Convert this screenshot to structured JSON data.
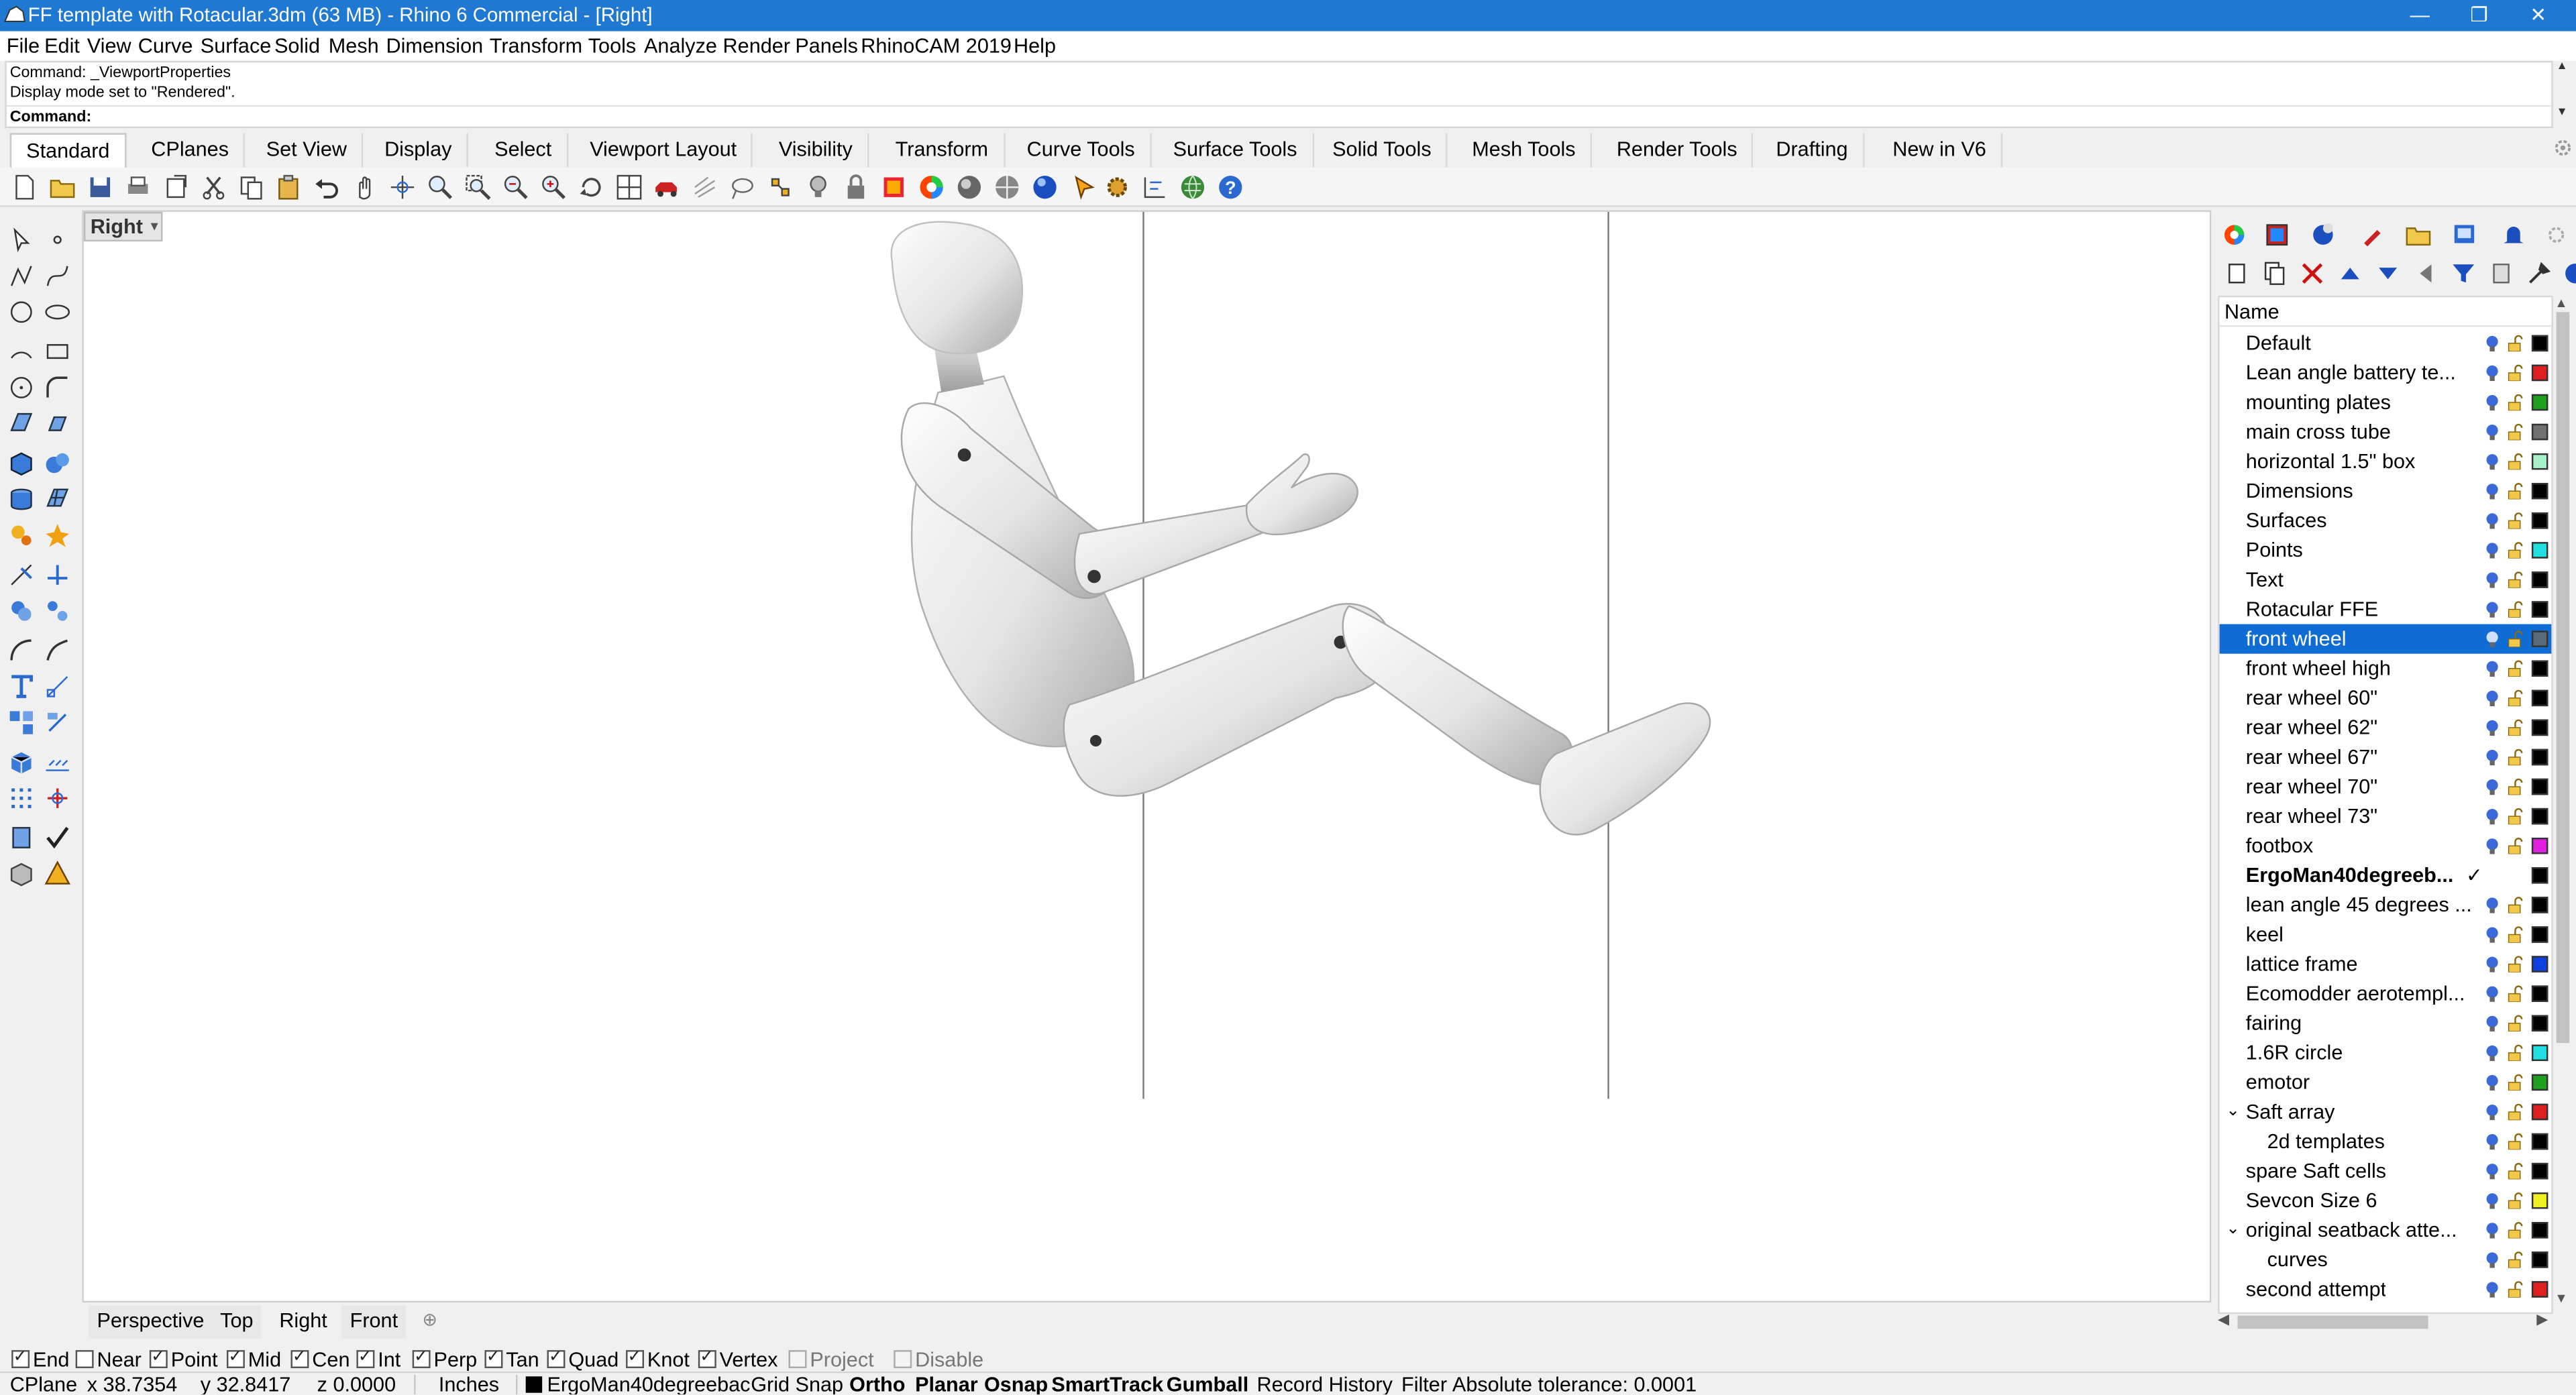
{
  "window": {
    "title": "FF template with Rotacular.3dm (63 MB) - Rhino 6 Commercial - [Right]",
    "minimize": "—",
    "maximize": "❐",
    "close": "✕"
  },
  "menu": [
    "File",
    "Edit",
    "View",
    "Curve",
    "Surface",
    "Solid",
    "Mesh",
    "Dimension",
    "Transform",
    "Tools",
    "Analyze",
    "Render",
    "Panels",
    "RhinoCAM 2019",
    "Help"
  ],
  "command_history": [
    "Command: _ViewportProperties",
    "Display mode set to \"Rendered\"."
  ],
  "command_prompt": "Command:",
  "toolbar_tabs": [
    "Standard",
    "CPlanes",
    "Set View",
    "Display",
    "Select",
    "Viewport Layout",
    "Visibility",
    "Transform",
    "Curve Tools",
    "Surface Tools",
    "Solid Tools",
    "Mesh Tools",
    "Render Tools",
    "Drafting",
    "New in V6"
  ],
  "active_toolbar_tab": "Standard",
  "toolbar_icons": [
    "new-icon",
    "open-icon",
    "save-icon",
    "print-icon",
    "import-icon",
    "cut-icon",
    "copy-icon",
    "paste-icon",
    "undo-icon",
    "pan-icon",
    "rotate-view-icon",
    "zoom-icon",
    "zoom-window-icon",
    "zoom-extents-icon",
    "zoom-selected-icon",
    "rotate-3d-icon",
    "four-view-icon",
    "car-icon",
    "grid-icon",
    "lasso-icon",
    "snap-icon",
    "light-icon",
    "lock-icon",
    "material-icon",
    "color-wheel-icon",
    "shade-icon",
    "render-icon",
    "sphere-icon",
    "pointer-icon",
    "gear-icon",
    "dimension-icon",
    "globe-icon",
    "help-icon"
  ],
  "viewport": {
    "name": "Right",
    "tabs": [
      "Perspective",
      "Top",
      "Right",
      "Front"
    ],
    "active_tab": "Right",
    "add_tab": "⊕"
  },
  "osnaps": [
    {
      "label": "End",
      "checked": true
    },
    {
      "label": "Near",
      "checked": false
    },
    {
      "label": "Point",
      "checked": true
    },
    {
      "label": "Mid",
      "checked": true
    },
    {
      "label": "Cen",
      "checked": true
    },
    {
      "label": "Int",
      "checked": true
    },
    {
      "label": "Perp",
      "checked": true
    },
    {
      "label": "Tan",
      "checked": true
    },
    {
      "label": "Quad",
      "checked": true
    },
    {
      "label": "Knot",
      "checked": true
    },
    {
      "label": "Vertex",
      "checked": true
    },
    {
      "label": "Project",
      "checked": false,
      "disabled": true
    },
    {
      "label": "Disable",
      "checked": false,
      "disabled": true
    }
  ],
  "status": {
    "cplane": "CPlane",
    "x": "x 38.7354",
    "y": "y 32.8417",
    "z": "z 0.0000",
    "units": "Inches",
    "layer": "ErgoMan40degreebac",
    "grid_snap": "Grid Snap",
    "ortho": "Ortho",
    "planar": "Planar",
    "osnap": "Osnap",
    "smarttrack": "SmartTrack",
    "gumball": "Gumball",
    "record_history": "Record History",
    "filter": "Filter",
    "tolerance": "Absolute tolerance: 0.0001"
  },
  "layers_panel": {
    "header": "Name",
    "tab_icons": [
      "color-wheel-icon",
      "layers-icon",
      "render-icon",
      "brush-icon",
      "folder-icon",
      "display-icon",
      "bell-icon",
      "settings-icon"
    ],
    "tool_icons": [
      "new-layer-icon",
      "new-sublayer-icon",
      "delete-icon",
      "move-up-icon",
      "move-down-icon",
      "move-left-icon",
      "filter-icon",
      "copy-icon",
      "tools-icon"
    ],
    "rows": [
      {
        "name": "Default",
        "color": "#000000",
        "indent": 0
      },
      {
        "name": "Lean angle battery te...",
        "color": "#e02020",
        "indent": 0
      },
      {
        "name": "mounting plates",
        "color": "#1fa01f",
        "indent": 0
      },
      {
        "name": "main cross tube",
        "color": "#707070",
        "indent": 0
      },
      {
        "name": "horizontal 1.5\" box",
        "color": "#a8f0c8",
        "indent": 0
      },
      {
        "name": "Dimensions",
        "color": "#000000",
        "indent": 0
      },
      {
        "name": "Surfaces",
        "color": "#000000",
        "indent": 0
      },
      {
        "name": "Points",
        "color": "#20e0e0",
        "indent": 0
      },
      {
        "name": "Text",
        "color": "#000000",
        "indent": 0
      },
      {
        "name": "Rotacular FFE",
        "color": "#000000",
        "indent": 0
      },
      {
        "name": "front wheel",
        "color": "#5a6a7a",
        "indent": 0,
        "selected": true
      },
      {
        "name": "front wheel high",
        "color": "#000000",
        "indent": 0
      },
      {
        "name": "rear wheel 60\"",
        "color": "#000000",
        "indent": 0
      },
      {
        "name": "rear wheel 62\"",
        "color": "#000000",
        "indent": 0
      },
      {
        "name": "rear wheel 67\"",
        "color": "#000000",
        "indent": 0
      },
      {
        "name": "rear wheel 70\"",
        "color": "#000000",
        "indent": 0
      },
      {
        "name": "rear wheel 73\"",
        "color": "#000000",
        "indent": 0
      },
      {
        "name": "footbox",
        "color": "#e020e0",
        "indent": 0
      },
      {
        "name": "ErgoMan40degreeb...",
        "color": "#000000",
        "indent": 0,
        "current": true,
        "check": "✓"
      },
      {
        "name": "lean angle 45 degrees ...",
        "color": "#000000",
        "indent": 0
      },
      {
        "name": "keel",
        "color": "#000000",
        "indent": 0
      },
      {
        "name": "lattice frame",
        "color": "#1040e0",
        "indent": 0
      },
      {
        "name": "Ecomodder aerotempl...",
        "color": "#000000",
        "indent": 0
      },
      {
        "name": "fairing",
        "color": "#000000",
        "indent": 0
      },
      {
        "name": "1.6R circle",
        "color": "#20e0e0",
        "indent": 0
      },
      {
        "name": "emotor",
        "color": "#1fa01f",
        "indent": 0
      },
      {
        "name": "Saft array",
        "color": "#e02020",
        "indent": 0,
        "expanded": true,
        "chev": "⌄"
      },
      {
        "name": "2d templates",
        "color": "#000000",
        "indent": 1
      },
      {
        "name": "spare Saft cells",
        "color": "#000000",
        "indent": 0
      },
      {
        "name": "Sevcon Size 6",
        "color": "#f0f020",
        "indent": 0
      },
      {
        "name": "original seatback atte...",
        "color": "#000000",
        "indent": 0,
        "expanded": true,
        "chev": "⌄"
      },
      {
        "name": "curves",
        "color": "#000000",
        "indent": 1
      },
      {
        "name": "second attempt",
        "color": "#e02020",
        "indent": 0
      }
    ]
  }
}
